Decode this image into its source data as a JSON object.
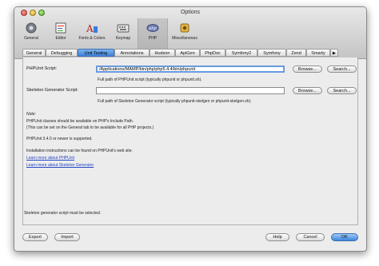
{
  "window": {
    "title": "Options"
  },
  "toolbar": {
    "items": [
      {
        "label": "General",
        "icon": "general-icon"
      },
      {
        "label": "Editor",
        "icon": "editor-icon"
      },
      {
        "label": "Fonts & Colors",
        "icon": "fonts-colors-icon"
      },
      {
        "label": "Keymap",
        "icon": "keymap-icon"
      },
      {
        "label": "PHP",
        "icon": "php-icon"
      },
      {
        "label": "Miscellaneous",
        "icon": "miscellaneous-icon"
      }
    ],
    "selected": "PHP"
  },
  "tabs": {
    "items": [
      "General",
      "Debugging",
      "Unit Testing",
      "Annotations",
      "Hudson",
      "ApiGen",
      "PhpDoc",
      "Symfony2",
      "Symfony",
      "Zend",
      "Smarty"
    ],
    "selected": "Unit Testing"
  },
  "form": {
    "phpunit": {
      "label": "PHPUnit Script:",
      "value": "/Applications/MAMP/bin/php/php5.4.4/bin/phpunit",
      "hint": "Full path of PHPUnit script (typically phpunit or phpunit.sh).",
      "browse": "Browse...",
      "search": "Search..."
    },
    "skelgen": {
      "label": "Skeleton Generator Script:",
      "value": "",
      "hint": "Full path of Skeleton Generator script (typically phpunit-skelgen or phpunit-skelgen.sh).",
      "browse": "Browse...",
      "search": "Search..."
    }
  },
  "notes": {
    "heading": "Note:",
    "line1": "PHPUnit classes should be available on PHP's Include Path.",
    "line2": "(This can be set on the General tab to be available for all PHP projects.)",
    "line3": "PHPUnit 3.4.0 or newer is supported.",
    "line4": "Installation instructions can be found on PHPUnit's web site.",
    "link1": "Learn more about PHPUnit",
    "link2": "Learn more about Skeleton Generator"
  },
  "status": "Skeleton generator script must be selected.",
  "footer": {
    "export": "Export",
    "import": "Import",
    "help": "Help",
    "cancel": "Cancel",
    "ok": "OK"
  }
}
